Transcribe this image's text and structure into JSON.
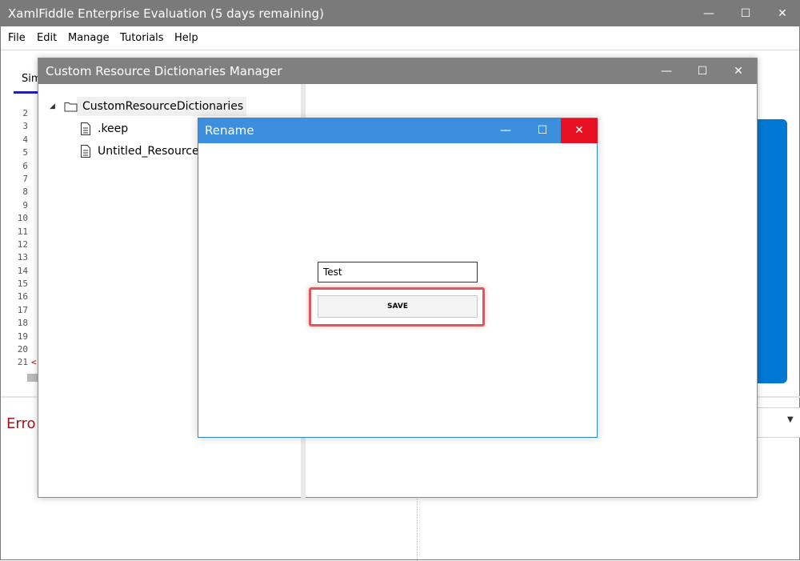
{
  "main_window": {
    "title": "XamlFiddle Enterprise Evaluation (5 days remaining)",
    "controls": {
      "minimize": "—",
      "maximize": "☐",
      "close": "✕"
    },
    "menu": [
      "File",
      "Edit",
      "Manage",
      "Tutorials",
      "Help"
    ],
    "tab_partial": "Sim",
    "line_numbers": [
      "2",
      "3",
      "4",
      "5",
      "6",
      "7",
      "8",
      "9",
      "10",
      "11",
      "12",
      "13",
      "14",
      "15",
      "16",
      "17",
      "18",
      "19",
      "20",
      "21"
    ],
    "code_fragment": "<",
    "errors_label": "Erro"
  },
  "crd_window": {
    "title": "Custom Resource Dictionaries Manager",
    "controls": {
      "minimize": "—",
      "maximize": "☐",
      "close": "✕"
    },
    "tree": {
      "root": "CustomResourceDictionaries",
      "children": [
        ".keep",
        "Untitled_Resource_"
      ]
    }
  },
  "rename_dialog": {
    "title": "Rename",
    "controls": {
      "minimize": "—",
      "maximize": "☐",
      "close": "✕"
    },
    "input_value": "Test",
    "save_label": "SAVE",
    "highlight_color": "#e15759"
  },
  "colors": {
    "titlebar_gray": "#7a7a7a",
    "dialog_blue": "#3c8fdc",
    "close_red": "#e81123",
    "accent_blue": "#0078d4"
  }
}
